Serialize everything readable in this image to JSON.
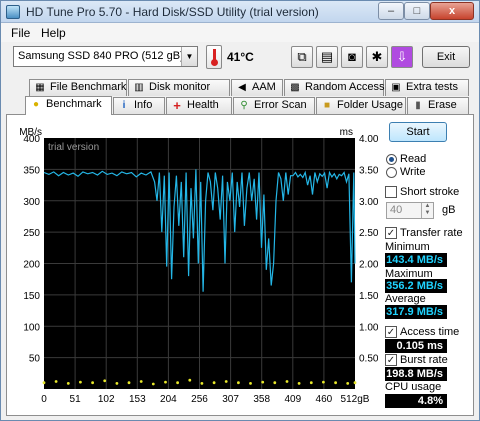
{
  "window": {
    "title": "HD Tune Pro 5.70 - Hard Disk/SSD Utility (trial version)",
    "minimize": "–",
    "maximize": "□",
    "close": "x"
  },
  "menu": {
    "file": "File",
    "help": "Help"
  },
  "toolbar": {
    "drive": "Samsung SSD 840 PRO (512 gB)",
    "temperature": "41°C",
    "exit": "Exit",
    "icons": [
      "copy-icon",
      "save-icon",
      "camera-icon",
      "settings-icon",
      "down-arrow-icon"
    ]
  },
  "tabs_top": [
    {
      "label": "File Benchmark",
      "icon": "file-icon"
    },
    {
      "label": "Disk monitor",
      "icon": "monitor-icon"
    },
    {
      "label": "AAM",
      "icon": "speaker-icon"
    },
    {
      "label": "Random Access",
      "icon": "random-icon"
    },
    {
      "label": "Extra tests",
      "icon": "extra-icon"
    }
  ],
  "tabs_bottom": [
    {
      "label": "Benchmark",
      "icon": "bulb-icon"
    },
    {
      "label": "Info",
      "icon": "info-icon"
    },
    {
      "label": "Health",
      "icon": "health-icon"
    },
    {
      "label": "Error Scan",
      "icon": "magnifier-icon"
    },
    {
      "label": "Folder Usage",
      "icon": "folder-icon"
    },
    {
      "label": "Erase",
      "icon": "trash-icon"
    }
  ],
  "controls": {
    "start": "Start",
    "read": "Read",
    "write": "Write",
    "read_selected": true,
    "short_stroke": "Short stroke",
    "short_stroke_value": "40",
    "gb_unit": "gB",
    "transfer_rate": "Transfer rate",
    "minimum_label": "Minimum",
    "minimum_value": "143.4 MB/s",
    "maximum_label": "Maximum",
    "maximum_value": "356.2 MB/s",
    "average_label": "Average",
    "average_value": "317.9 MB/s",
    "access_time": "Access time",
    "access_time_value": "0.105 ms",
    "burst_rate": "Burst rate",
    "burst_rate_value": "198.8 MB/s",
    "cpu_usage_label": "CPU usage",
    "cpu_usage_value": "4.8%"
  },
  "chart_data": {
    "type": "line",
    "watermark": "trial version",
    "ylabel_left": "MB/s",
    "ylabel_right": "ms",
    "y_left_ticks": [
      "400",
      "350",
      "300",
      "250",
      "200",
      "150",
      "100",
      "50",
      ""
    ],
    "y_right_ticks": [
      "4.00",
      "3.50",
      "3.00",
      "2.50",
      "2.00",
      "1.50",
      "1.00",
      "0.50",
      ""
    ],
    "x_ticks": [
      "0",
      "51",
      "102",
      "153",
      "204",
      "256",
      "307",
      "358",
      "409",
      "460",
      "512gB"
    ],
    "ylim": [
      0,
      400
    ],
    "xlim": [
      0,
      512
    ],
    "y2lim": [
      0,
      4
    ],
    "grid": true,
    "colors": {
      "background": "#000000",
      "grid": "#3a3a3a",
      "transfer": "#24b6e6",
      "access": "#e6e62a"
    },
    "series": [
      {
        "name": "Transfer rate",
        "color": "#24b6e6",
        "x": [
          0,
          8,
          16,
          24,
          32,
          40,
          48,
          56,
          64,
          72,
          80,
          88,
          96,
          104,
          112,
          120,
          128,
          136,
          144,
          152,
          160,
          168,
          176,
          182,
          186,
          190,
          194,
          198,
          202,
          206,
          210,
          214,
          218,
          222,
          226,
          230,
          234,
          238,
          242,
          246,
          250,
          254,
          258,
          262,
          266,
          270,
          274,
          278,
          282,
          286,
          290,
          294,
          298,
          302,
          306,
          310,
          314,
          318,
          322,
          326,
          330,
          334,
          338,
          342,
          346,
          350,
          354,
          358,
          362,
          366,
          370,
          374,
          378,
          382,
          386,
          390,
          394,
          398,
          402,
          406,
          410,
          414,
          418,
          422,
          426,
          430,
          434,
          438,
          442,
          446,
          450,
          454,
          458,
          462,
          466,
          470,
          474,
          478,
          482,
          486,
          490,
          494,
          498,
          502,
          506,
          510,
          512
        ],
        "y": [
          345,
          342,
          346,
          340,
          345,
          341,
          344,
          339,
          346,
          343,
          345,
          341,
          347,
          342,
          344,
          340,
          346,
          343,
          345,
          338,
          344,
          341,
          346,
          330,
          300,
          345,
          250,
          340,
          195,
          345,
          175,
          290,
          340,
          260,
          330,
          210,
          345,
          180,
          320,
          240,
          350,
          200,
          330,
          155,
          300,
          345,
          330,
          285,
          345,
          320,
          270,
          340,
          200,
          330,
          300,
          345,
          250,
          330,
          290,
          345,
          260,
          320,
          345,
          300,
          335,
          270,
          345,
          225,
          310,
          190,
          240,
          165,
          200,
          300,
          345,
          335,
          300,
          345,
          310,
          340,
          340,
          345,
          338,
          342,
          337,
          345,
          325,
          340,
          310,
          345,
          330,
          343,
          339,
          344,
          320,
          345,
          338,
          343,
          335,
          342,
          340,
          345,
          330,
          343,
          170,
          345,
          200
        ]
      },
      {
        "name": "Access time",
        "color": "#e6e62a",
        "x": [
          0,
          20,
          40,
          60,
          80,
          100,
          120,
          140,
          160,
          180,
          200,
          220,
          240,
          260,
          280,
          300,
          320,
          340,
          360,
          380,
          400,
          420,
          440,
          460,
          480,
          500,
          512
        ],
        "y": [
          0.1,
          0.12,
          0.09,
          0.11,
          0.1,
          0.13,
          0.09,
          0.1,
          0.12,
          0.08,
          0.11,
          0.1,
          0.14,
          0.09,
          0.1,
          0.12,
          0.1,
          0.09,
          0.11,
          0.1,
          0.12,
          0.09,
          0.1,
          0.11,
          0.1,
          0.09,
          0.1
        ]
      }
    ]
  }
}
